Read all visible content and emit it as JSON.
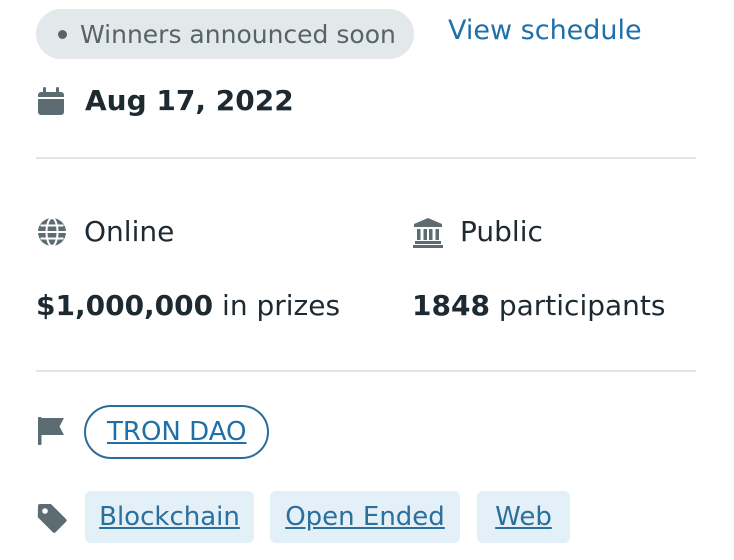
{
  "status": {
    "label": "Winners announced soon"
  },
  "schedule_link": {
    "label": "View schedule"
  },
  "date": {
    "text": "Aug 17, 2022",
    "icon": "calendar-icon"
  },
  "location": {
    "label": "Online",
    "icon": "globe-icon"
  },
  "visibility": {
    "label": "Public",
    "icon": "institution-icon"
  },
  "prizes": {
    "amount": "$1,000,000",
    "suffix": "in prizes"
  },
  "participants": {
    "count": "1848",
    "suffix": "participants"
  },
  "organizer": {
    "icon": "flag-icon",
    "label": "TRON DAO"
  },
  "tags": {
    "icon": "tag-icon",
    "items": [
      {
        "label": "Blockchain"
      },
      {
        "label": "Open Ended"
      },
      {
        "label": "Web"
      }
    ]
  },
  "colors": {
    "link": "#1f6fa8",
    "pill_bg": "#e3e9ea",
    "tag_bg": "#e3f0f8",
    "icon": "#5d6b73",
    "text": "#1d2a32"
  }
}
